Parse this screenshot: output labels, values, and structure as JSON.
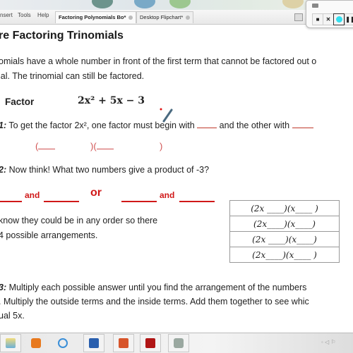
{
  "window": {
    "menu": [
      "nsert",
      "Tools",
      "Help"
    ],
    "tabs": [
      {
        "label": "Factoring Polynomials Bo*",
        "active": true
      },
      {
        "label": "Desktop Flipchart*",
        "active": false
      }
    ],
    "controls": [
      "stop-icon",
      "close-icon",
      "record-icon",
      "pause-icon"
    ],
    "record_color": "#33e0f0"
  },
  "document": {
    "title": "re Factoring Trinomials",
    "intro_line1": "omials have a whole number in front of the first term that cannot be factored out o",
    "intro_line2": "ial.  The trinomial can still be factored.",
    "factor_label": "Factor",
    "expression": "2x² + 5x − 3",
    "step1_num": "1:",
    "step1_text_a": " To get the factor 2x², one factor must begin with ",
    "step1_text_b": " and the other with ",
    "parens": [
      "(",
      ")(",
      ")"
    ],
    "step2_num": "2:",
    "step2_text": " Now think!   What two numbers give a product of -3?",
    "and_label": "and",
    "or_label": "or",
    "order_line1": "know they could be in any order so there",
    "order_line2": "4 possible arrangements.",
    "arrangements": [
      "(2x ____)(x____ )",
      "(2x____)(x____)",
      "(2x ____)(x____)",
      "(2x____)(x____ )"
    ],
    "step3_num": "3:",
    "step3_line1": "  Multiply each possible answer until you find the arrangement of the numbers",
    "step3_line2": ".  Multiply the outside terms and the inside terms.  Add them together to see whic",
    "step3_line3": "ual 5x.",
    "accent_red": "#d01818"
  },
  "taskbar": {
    "items": [
      "file-explorer-icon",
      "media-player-icon",
      "internet-explorer-icon",
      "word-icon",
      "powerpoint-icon",
      "acrobat-icon",
      "flipchart-icon"
    ]
  }
}
